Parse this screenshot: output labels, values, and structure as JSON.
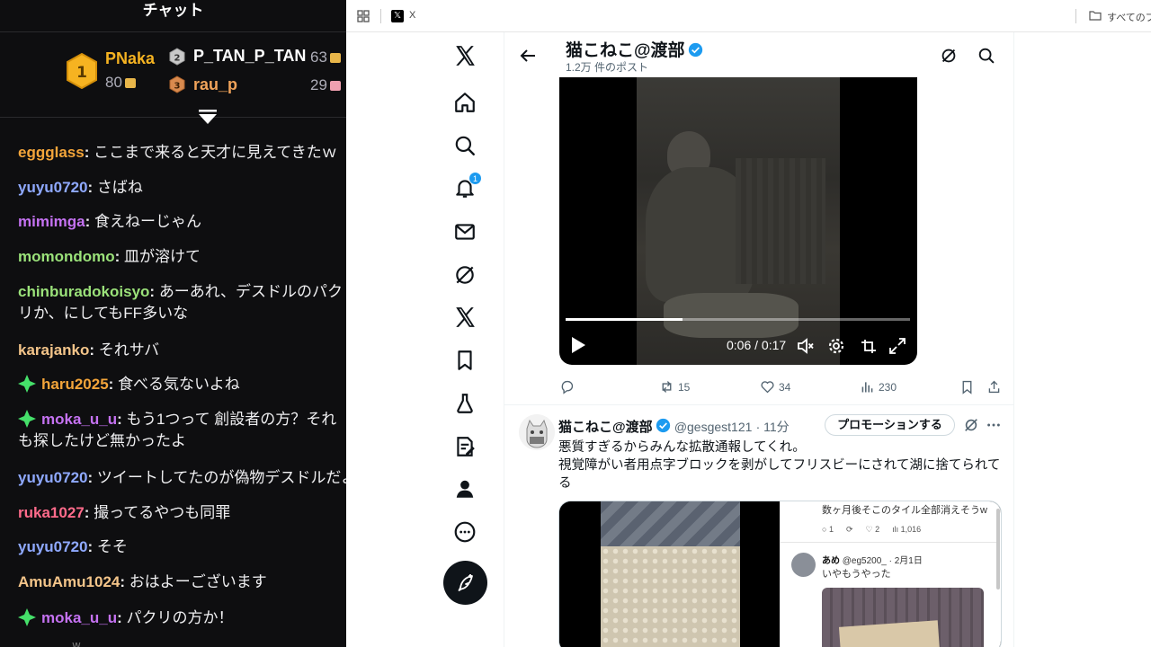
{
  "chat": {
    "title": "チャット",
    "leaderboard": [
      {
        "rank": "1",
        "name": "PNaka",
        "points": "80"
      },
      {
        "rank": "2",
        "name": "P_TAN_P_TAN",
        "points": "63"
      },
      {
        "rank": "3",
        "name": "rau_p",
        "points": "29"
      }
    ],
    "messages": [
      {
        "user": "eggglass",
        "text": "ここまで来ると天才に見えてきたｗ",
        "color": "#f4a53a"
      },
      {
        "user": "yuyu0720",
        "text": "さばね",
        "color": "#8fa9ff"
      },
      {
        "user": "mimimga",
        "text": "食えねーじゃん",
        "color": "#c572f2"
      },
      {
        "user": "momondomo",
        "text": "皿が溶けて",
        "color": "#9be27a"
      },
      {
        "user": "chinburadokoisyo",
        "text": "あーあれ、デスドルのパクリか、にしてもFF多いな",
        "color": "#9be27a"
      },
      {
        "user": "karajanko",
        "text": "それサバ",
        "color": "#f4c58a"
      },
      {
        "user": "haru2025",
        "text": "食べる気ないよね",
        "color": "#f4a53a"
      },
      {
        "user": "moka_u_u",
        "text": "もう1つって 創設者の方？それも探したけど無かったよ",
        "color": "#c572f2"
      },
      {
        "user": "yuyu0720",
        "text": "ツイートしてたのが偽物デスドルだよ",
        "color": "#8fa9ff"
      },
      {
        "user": "ruka1027",
        "text": "撮ってるやつも同罪",
        "color": "#ff6b8b"
      },
      {
        "user": "yuyu0720",
        "text": "そそ",
        "color": "#8fa9ff"
      },
      {
        "user": "AmuAmu1024",
        "text": "おはよーございます",
        "color": "#f4c58a"
      },
      {
        "user": "moka_u_u",
        "text": "パクリの方か！",
        "color": "#c572f2"
      }
    ],
    "bottom_mark": "w"
  },
  "browser": {
    "tab_title": "X",
    "tab_favicon": "𝕏",
    "bookmark_folder": "すべてのブックマーク"
  },
  "x": {
    "notifications_count": "1",
    "header": {
      "name": "猫こねこ@渡部",
      "post_count": "1.2万 件のポスト"
    },
    "video": {
      "time": "0:06 / 0:17",
      "progress": 0.34
    },
    "tweet1_actions": {
      "retweets": "15",
      "likes": "34",
      "views": "230"
    },
    "tweet2": {
      "name": "猫こねこ@渡部",
      "handle": "@gesgest121",
      "time": "· 11分",
      "promote_label": "プロモーションする",
      "text_line1": "悪質すぎるからみんな拡散通報してくれ。",
      "text_line2": "視覚障がい者用点字ブロックを剥がしてフリスビーにされて湖に捨てられてる"
    },
    "media": {
      "reply_text": "数ヶ月後そこのタイル全部消えそうw",
      "reply_acts": [
        "1",
        "",
        "2",
        "1,016"
      ],
      "reply_user": "あめ",
      "reply_handle": "@eg5200_ · 2月1日",
      "reply_text2": "いやもうやった"
    }
  },
  "colors": {
    "accent": "#1d9bf0",
    "chat_bg": "#0e0e10"
  }
}
